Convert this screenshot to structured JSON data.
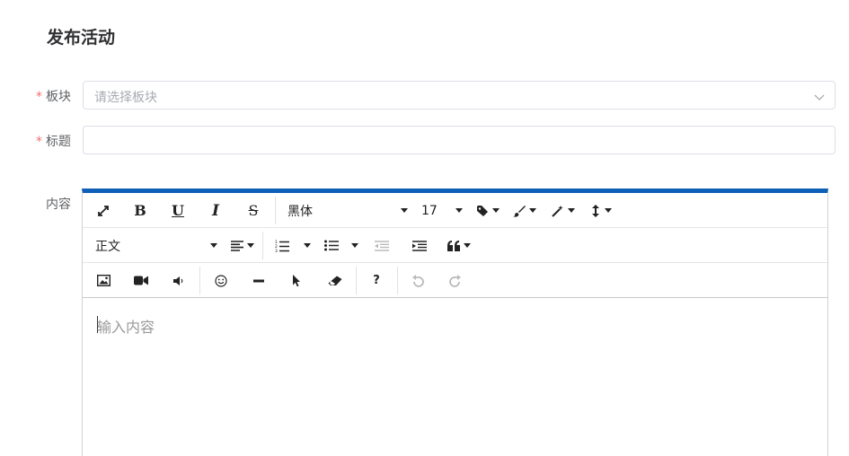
{
  "page": {
    "title": "发布活动"
  },
  "form": {
    "board": {
      "label": "板块",
      "required_mark": "*",
      "placeholder": "请选择板块"
    },
    "title": {
      "label": "标题",
      "required_mark": "*",
      "value": ""
    },
    "content": {
      "label": "内容"
    }
  },
  "editor": {
    "accent_color": "#0e5fb7",
    "font_family_value": "黑体",
    "font_size_value": "17",
    "paragraph_value": "正文",
    "placeholder": "输入内容",
    "buttons": {
      "bold": "B",
      "underline": "U",
      "italic": "I",
      "strike": "S",
      "help": "?"
    }
  }
}
